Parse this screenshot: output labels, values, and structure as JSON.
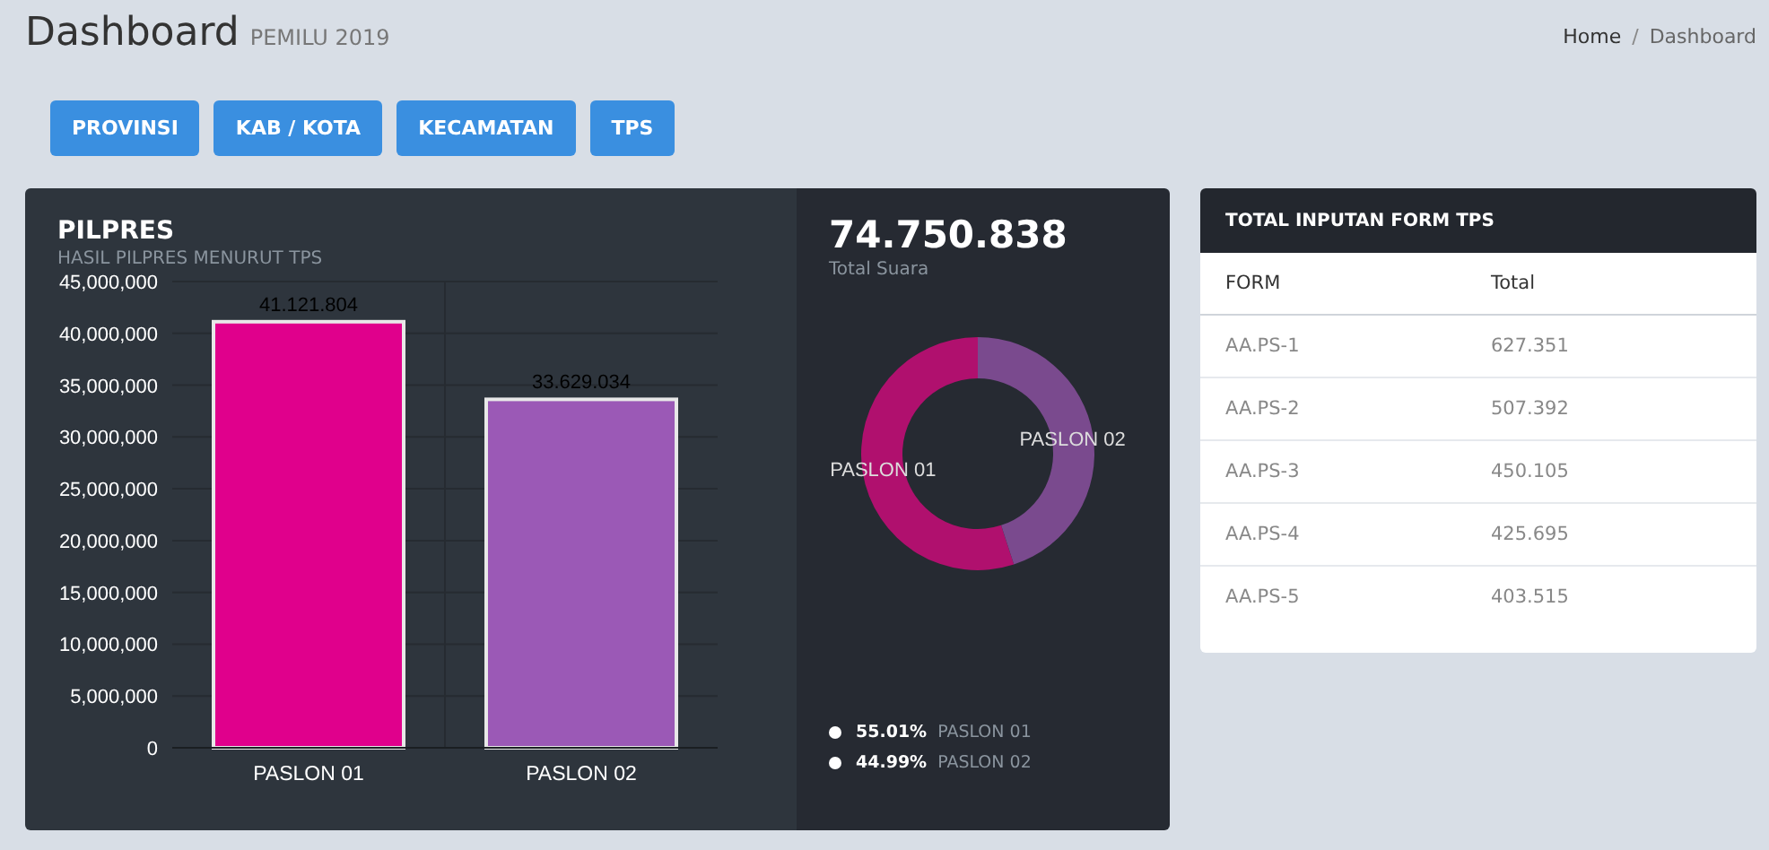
{
  "header": {
    "title": "Dashboard",
    "subtitle": "PEMILU 2019",
    "breadcrumb_separator": "/",
    "breadcrumb": [
      {
        "label": "Home",
        "selected": false
      },
      {
        "label": "Dashboard",
        "selected": true
      }
    ]
  },
  "filter_buttons": [
    "PROVINSI",
    "KAB / KOTA",
    "KECAMATAN",
    "TPS"
  ],
  "pilpres": {
    "title": "PILPRES",
    "subtitle": "HASIL PILPRES MENURUT TPS",
    "chart_data": {
      "type": "bar",
      "categories": [
        "PASLON 01",
        "PASLON 02"
      ],
      "series": [
        {
          "values": [
            41121804,
            33629034
          ]
        }
      ],
      "colors": [
        "#e0008c",
        "#9b59b6"
      ],
      "grid": true,
      "ylim": [
        0,
        45000000
      ],
      "yticks": [
        {
          "value": 0,
          "label": "0"
        },
        {
          "value": 5000000,
          "label": "5,000,000"
        },
        {
          "value": 10000000,
          "label": "10,000,000"
        },
        {
          "value": 15000000,
          "label": "15,000,000"
        },
        {
          "value": 20000000,
          "label": "20,000,000"
        },
        {
          "value": 25000000,
          "label": "25,000,000"
        },
        {
          "value": 30000000,
          "label": "30,000,000"
        },
        {
          "value": 35000000,
          "label": "35,000,000"
        },
        {
          "value": 40000000,
          "label": "40,000,000"
        },
        {
          "value": 45000000,
          "label": "45,000,000"
        }
      ],
      "value_labels": [
        "41.121.804",
        "33.629.034"
      ]
    }
  },
  "total": {
    "value": "74.750.838",
    "label": "Total Suara",
    "chart_data": {
      "type": "donut",
      "categories": [
        "PASLON 01",
        "PASLON 02"
      ],
      "series": [
        {
          "values": [
            55.01,
            44.99
          ]
        }
      ],
      "colors": [
        "#b0106e",
        "#7a4a8e"
      ]
    },
    "legend": [
      {
        "percent": "55.01%",
        "label": "PASLON 01"
      },
      {
        "percent": "44.99%",
        "label": "PASLON 02"
      }
    ]
  },
  "form_table": {
    "title": "TOTAL INPUTAN FORM TPS",
    "columns": [
      "FORM",
      "Total"
    ],
    "rows": [
      [
        "AA.PS-1",
        "627.351"
      ],
      [
        "AA.PS-2",
        "507.392"
      ],
      [
        "AA.PS-3",
        "450.105"
      ],
      [
        "AA.PS-4",
        "425.695"
      ],
      [
        "AA.PS-5",
        "403.515"
      ]
    ]
  }
}
